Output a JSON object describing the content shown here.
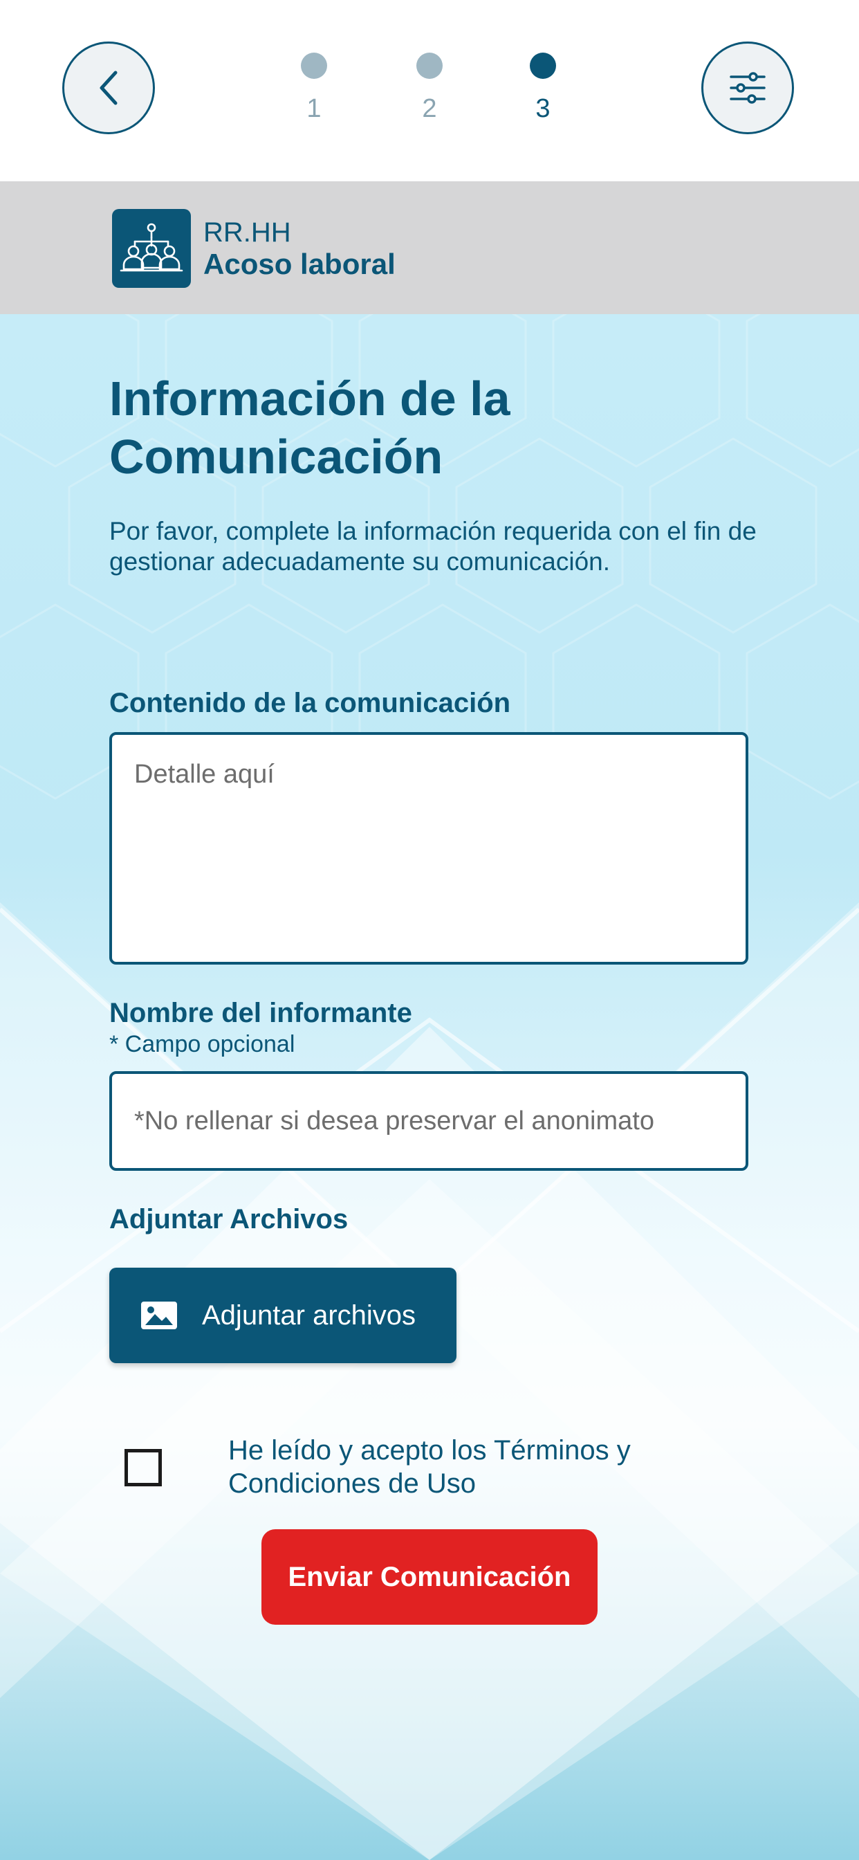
{
  "header": {
    "steps": [
      {
        "number": "1",
        "active": false
      },
      {
        "number": "2",
        "active": false
      },
      {
        "number": "3",
        "active": true
      }
    ],
    "back_icon": "chevron-left-icon",
    "filter_icon": "sliders-icon"
  },
  "category": {
    "title": "RR.HH",
    "subtitle": "Acoso laboral",
    "icon": "team-icon"
  },
  "form": {
    "heading": "Información de la Comunicación",
    "intro": "Por favor, complete la información requerida con el fin de gestionar adecuadamente su comunicación.",
    "content_label": "Contenido de la comunicación",
    "content_placeholder": "Detalle aquí",
    "name_label": "Nombre del informante",
    "name_sublabel": "* Campo opcional",
    "name_placeholder": "*No rellenar si desea preservar el anonimato",
    "attach_label": "Adjuntar Archivos",
    "attach_button": "Adjuntar archivos",
    "terms_text": "He leído y acepto los Términos y Condiciones de Uso",
    "submit_button": "Enviar Comunicación"
  },
  "colors": {
    "primary": "#0b5677",
    "danger": "#e12222",
    "inactive_step": "#9fb7c3"
  }
}
